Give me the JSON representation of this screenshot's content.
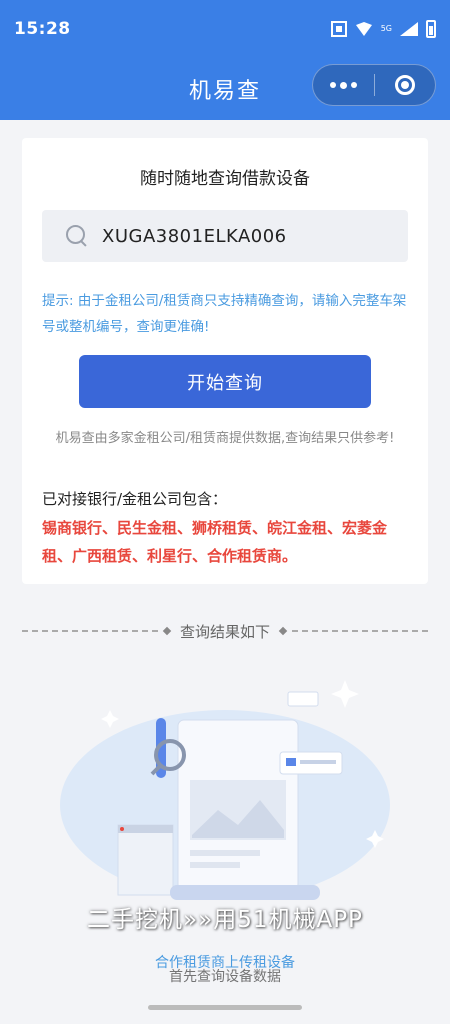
{
  "status_bar": {
    "time": "15:28",
    "network": "5G"
  },
  "nav": {
    "title": "机易查"
  },
  "card": {
    "title": "随时随地查询借款设备",
    "search": {
      "value": "XUGA3801ELKA006"
    },
    "hint": "提示: 由于金租公司/租赁商只支持精确查询，请输入完整车架号或整机编号，查询更准确!",
    "start_button": "开始查询",
    "note": "机易查由多家金租公司/租赁商提供数据,查询结果只供参考!",
    "partners_title": "已对接银行/金租公司包含：",
    "partners_list": "锡商银行、民生金租、狮桥租赁、皖江金租、宏菱金租、广西租赁、利星行、合作租赁商。"
  },
  "results": {
    "header": "查询结果如下"
  },
  "ad_overlay": "二手挖机»»用51机械APP",
  "bottom": {
    "link": "合作租赁商上传租设备",
    "sub": "首先查询设备数据"
  },
  "colors": {
    "primary": "#3a7fe6",
    "button": "#3a67d8",
    "hint": "#4a9be0",
    "partners": "#e8473d"
  }
}
